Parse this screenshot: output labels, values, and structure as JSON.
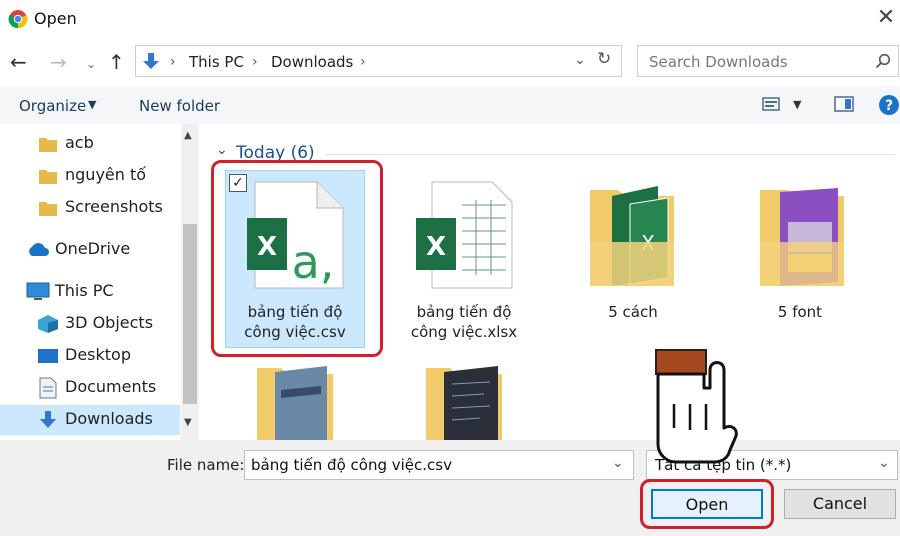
{
  "window": {
    "title": "Open"
  },
  "address": {
    "parts": [
      "This PC",
      "Downloads"
    ]
  },
  "search": {
    "placeholder": "Search Downloads"
  },
  "toolbar": {
    "organize": "Organize",
    "new_folder": "New folder"
  },
  "sidebar": {
    "items": [
      {
        "label": "acb",
        "icon": "folder-icon"
      },
      {
        "label": "nguyên tố",
        "icon": "folder-icon"
      },
      {
        "label": "Screenshots",
        "icon": "folder-icon"
      },
      {
        "label": "OneDrive",
        "icon": "cloud-icon"
      },
      {
        "label": "This PC",
        "icon": "computer-icon"
      },
      {
        "label": "3D Objects",
        "icon": "cube-icon"
      },
      {
        "label": "Desktop",
        "icon": "desktop-icon"
      },
      {
        "label": "Documents",
        "icon": "document-icon"
      },
      {
        "label": "Downloads",
        "icon": "download-icon"
      }
    ]
  },
  "content": {
    "group_label": "Today (6)",
    "files": [
      {
        "label1": "bảng tiến độ",
        "label2": "công việc.csv"
      },
      {
        "label1": "bảng tiến độ",
        "label2": "công việc.xlsx"
      },
      {
        "label1": "5 cách",
        "label2": ""
      },
      {
        "label1": "5 font",
        "label2": ""
      }
    ]
  },
  "bottom": {
    "file_name_label": "File name:",
    "file_name_value": "bảng tiến độ công việc.csv",
    "file_type": "Tất cả tệp tin (*.*)",
    "open": "Open",
    "cancel": "Cancel"
  },
  "colors": {
    "highlight": "#d0202e",
    "selection": "#cce8ff",
    "excel_green": "#1d7044",
    "folder": "#f1cb6a"
  }
}
